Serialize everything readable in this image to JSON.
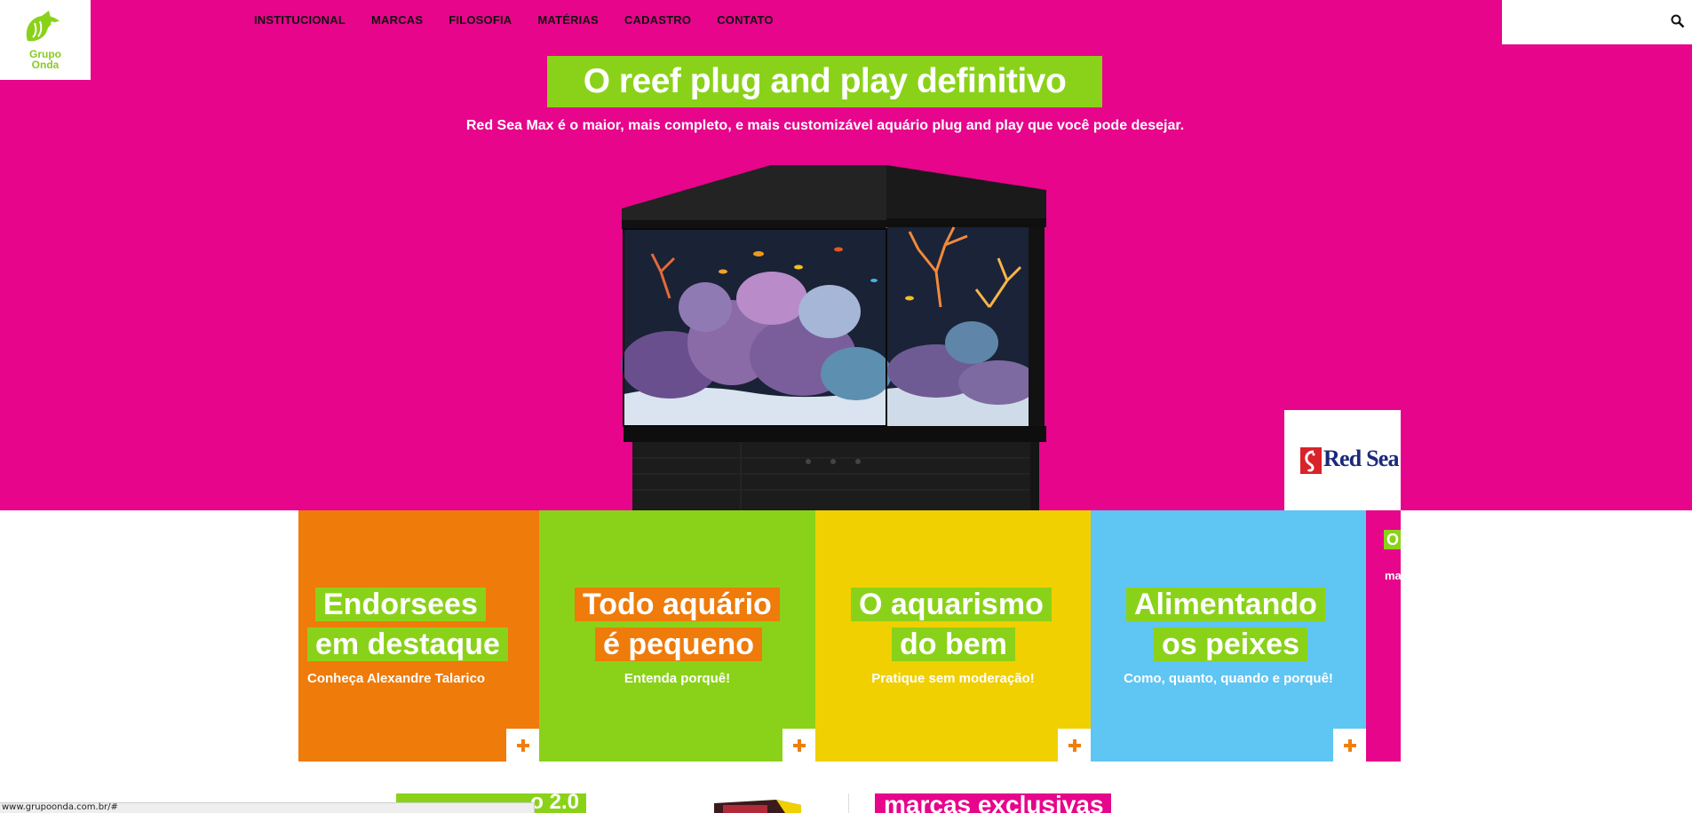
{
  "site": {
    "logo_line1": "Grupo",
    "logo_line2": "Onda",
    "logo_icon": "fish-logo-icon",
    "brand_colors": {
      "pink": "#e6058b",
      "green": "#8ad219",
      "orange": "#ef7b0a",
      "yellow": "#f0d000",
      "blue": "#5fc5f3"
    }
  },
  "nav": {
    "items": [
      {
        "label": "INSTITUCIONAL"
      },
      {
        "label": "MARCAS"
      },
      {
        "label": "FILOSOFIA"
      },
      {
        "label": "MATÉRIAS"
      },
      {
        "label": "CADASTRO"
      },
      {
        "label": "CONTATO"
      }
    ]
  },
  "search": {
    "value": "",
    "placeholder": "",
    "icon": "search-icon"
  },
  "hero": {
    "headline": "O reef plug and play definitivo",
    "subline": "Red Sea Max é o maior, mais completo, e mais customizável aquário plug and play que você pode desejar.",
    "brand_badge": "Red Sea"
  },
  "tiles": [
    {
      "line1": "Endorsees",
      "line2": "em destaque",
      "sub": "Conheça Alexandre Talarico",
      "more": "plus-icon"
    },
    {
      "line1": "Todo aquário",
      "line2": "é pequeno",
      "sub": "Entenda porquê!",
      "more": "plus-icon"
    },
    {
      "line1": "O aquarismo",
      "line2": "do bem",
      "sub": "Pratique sem moderação!",
      "more": "plus-icon"
    },
    {
      "line1": "Alimentando",
      "line2": "os peixes",
      "sub": "Como, quanto, quando e porquê!",
      "more": "plus-icon"
    },
    {
      "line1": "O",
      "sub": "ma"
    }
  ],
  "bottom": {
    "left_heading_fragment": "o 2.0",
    "right_heading": "marcas exclusivas"
  },
  "statusbar": {
    "url": "www.grupoonda.com.br/#"
  }
}
